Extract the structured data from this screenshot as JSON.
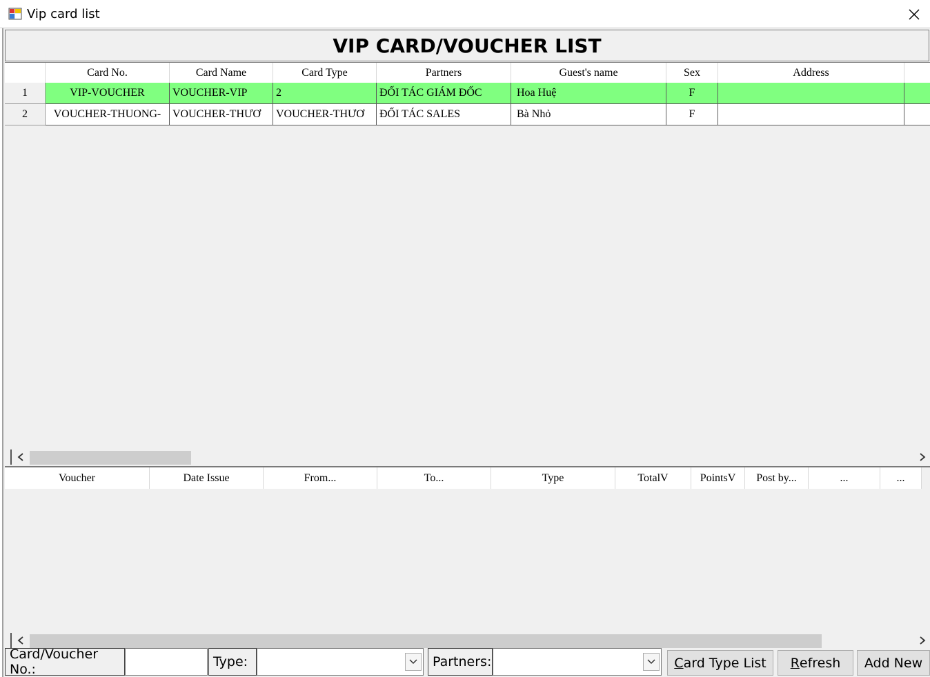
{
  "window": {
    "title": "Vip card list"
  },
  "heading": "VIP CARD/VOUCHER LIST",
  "cards_table": {
    "columns": [
      "Card No.",
      "Card Name",
      "Card Type",
      "Partners",
      "Guest's name",
      "Sex",
      "Address"
    ],
    "rows": [
      {
        "index": "1",
        "card_no": "VIP-VOUCHER",
        "card_name": "VOUCHER-VIP",
        "card_type": "2",
        "partners": "ĐỐI TÁC GIÁM ĐỐC",
        "guest_name": "Hoa Huệ",
        "sex": "F",
        "address": ""
      },
      {
        "index": "2",
        "card_no": "VOUCHER-THUONG-",
        "card_name": "VOUCHER-THƯƠ",
        "card_type": "VOUCHER-THƯƠ",
        "partners": "ĐỐI TÁC SALES",
        "guest_name": "Bà Nhỏ",
        "sex": "F",
        "address": ""
      }
    ],
    "selected_row_color": "#80ff80"
  },
  "vouchers_table": {
    "columns": [
      "Voucher",
      "Date Issue",
      "From...",
      "To...",
      "Type",
      "TotalV",
      "PointsV",
      "Post by...",
      "...",
      "..."
    ]
  },
  "filters": {
    "card_no_label": "Card/Voucher No.:",
    "card_no_value": "",
    "type_label": "Type:",
    "type_value": "",
    "partners_label": "Partners:",
    "partners_value": ""
  },
  "buttons": {
    "card_type_list": {
      "mnemonic": "C",
      "rest": "ard Type List"
    },
    "refresh": {
      "mnemonic": "R",
      "rest": "efresh"
    },
    "add_new": "Add New"
  },
  "icons": {
    "app": "app-window-icon",
    "close": "close-icon",
    "scroll_left": "chevron-left-icon",
    "scroll_right": "chevron-right-icon",
    "dropdown": "chevron-down-icon"
  }
}
